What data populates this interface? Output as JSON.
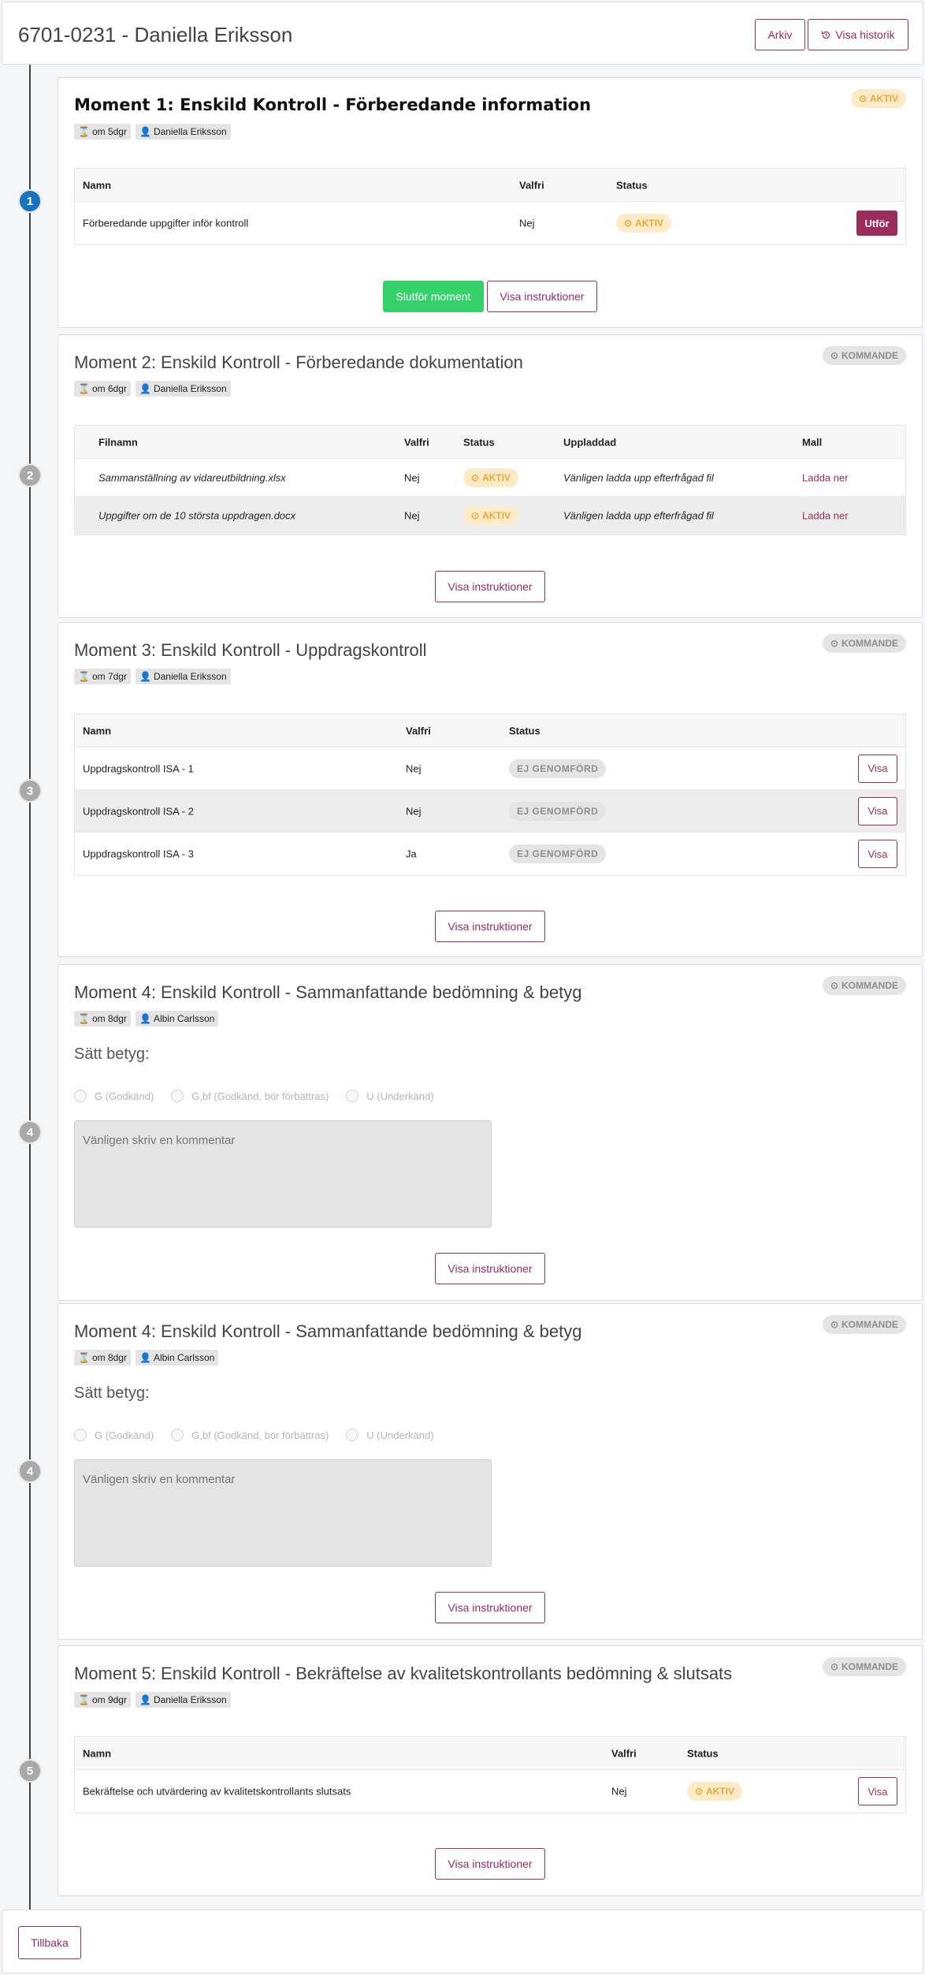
{
  "header": {
    "title": "6701-0231 - Daniella Eriksson",
    "archive_label": "Arkiv",
    "history_label": "Visa historik"
  },
  "icons": {
    "history": "history-icon",
    "hourglass": "hourglass-icon",
    "user": "user-icon",
    "clock": "clock-icon"
  },
  "colors": {
    "brand": "#9b2c5c",
    "active_marker": "#1a73c0",
    "inactive_marker": "#a9a9a9",
    "success": "#36d16b",
    "status_active_bg": "#fdebc7",
    "status_active_text": "#e9a838",
    "status_inactive_bg": "#e4e4e4"
  },
  "moments": [
    {
      "marker": "1",
      "title": "Moment 1: Enskild Kontroll - Förberedande information",
      "due": "om 5dgr",
      "person": "Daniella Eriksson",
      "status": "AKTIV",
      "table": {
        "columns": [
          "Namn",
          "Valfri",
          "Status"
        ],
        "rows": [
          {
            "name": "Förberedande uppgifter inför kontroll",
            "optional": "Nej",
            "status": "AKTIV",
            "action": "Utför"
          }
        ]
      },
      "complete_label": "Slutför moment",
      "instructions_label": "Visa instruktioner"
    },
    {
      "marker": "2",
      "title": "Moment 2: Enskild Kontroll - Förberedande dokumentation",
      "due": "om 6dgr",
      "person": "Daniella Eriksson",
      "status": "KOMMANDE",
      "table": {
        "columns": [
          "Filnamn",
          "Valfri",
          "Status",
          "Uppladdad",
          "Mall"
        ],
        "rows": [
          {
            "name": "Sammanställning av vidareutbildning.xlsx",
            "optional": "Nej",
            "status": "AKTIV",
            "uploaded": "Vänligen ladda upp efterfrågad fil",
            "template": "Ladda ner"
          },
          {
            "name": "Uppgifter om de 10 största uppdragen.docx",
            "optional": "Nej",
            "status": "AKTIV",
            "uploaded": "Vänligen ladda upp efterfrågad fil",
            "template": "Ladda ner"
          }
        ]
      },
      "instructions_label": "Visa instruktioner"
    },
    {
      "marker": "3",
      "title": "Moment 3: Enskild Kontroll - Uppdragskontroll",
      "due": "om 7dgr",
      "person": "Daniella Eriksson",
      "status": "KOMMANDE",
      "table": {
        "columns": [
          "Namn",
          "Valfri",
          "Status"
        ],
        "rows": [
          {
            "name": "Uppdragskontroll ISA - 1",
            "optional": "Nej",
            "status": "EJ GENOMFÖRD",
            "action": "Visa"
          },
          {
            "name": "Uppdragskontroll ISA - 2",
            "optional": "Nej",
            "status": "EJ GENOMFÖRD",
            "action": "Visa"
          },
          {
            "name": "Uppdragskontroll ISA - 3",
            "optional": "Ja",
            "status": "EJ GENOMFÖRD",
            "action": "Visa"
          }
        ]
      },
      "instructions_label": "Visa instruktioner"
    },
    {
      "marker": "4",
      "title": "Moment 4: Enskild Kontroll - Sammanfattande bedömning & betyg",
      "due": "om 8dgr",
      "person": "Albin Carlsson",
      "status": "KOMMANDE",
      "grade_label": "Sätt betyg:",
      "grade_options": [
        "G (Godkänd)",
        "G,bf (Godkänd, bör förbättras)",
        "U (Underkänd)"
      ],
      "comment_placeholder": "Vänligen skriv en kommentar",
      "instructions_label": "Visa instruktioner"
    },
    {
      "marker": "4",
      "title": "Moment 4: Enskild Kontroll - Sammanfattande bedömning & betyg",
      "due": "om 8dgr",
      "person": "Albin Carlsson",
      "status": "KOMMANDE",
      "grade_label": "Sätt betyg:",
      "grade_options": [
        "G (Godkänd)",
        "G,bf (Godkänd, bör förbättras)",
        "U (Underkänd)"
      ],
      "comment_placeholder": "Vänligen skriv en kommentar",
      "instructions_label": "Visa instruktioner"
    },
    {
      "marker": "5",
      "title": "Moment 5: Enskild Kontroll - Bekräftelse av kvalitetskontrollants bedömning & slutsats",
      "due": "om 9dgr",
      "person": "Daniella Eriksson",
      "status": "KOMMANDE",
      "table": {
        "columns": [
          "Namn",
          "Valfri",
          "Status"
        ],
        "rows": [
          {
            "name": "Bekräftelse och utvärdering av kvalitetskontrollants slutsats",
            "optional": "Nej",
            "status": "AKTIV",
            "action": "Visa"
          }
        ]
      },
      "instructions_label": "Visa instruktioner"
    }
  ],
  "footer": {
    "back_label": "Tillbaka"
  }
}
